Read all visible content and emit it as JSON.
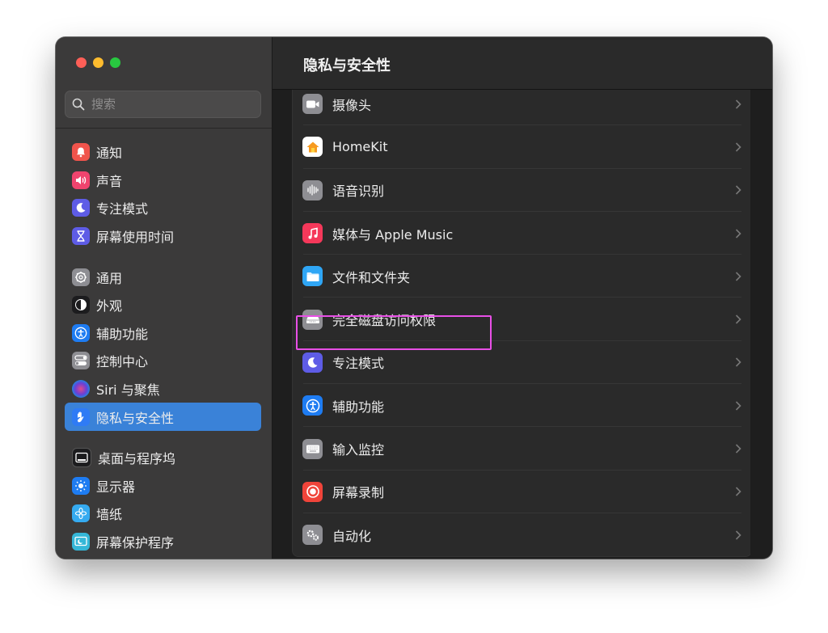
{
  "window": {
    "title": "隐私与安全性"
  },
  "search": {
    "placeholder": "搜索"
  },
  "sidebar": {
    "items": [
      {
        "label": "通知",
        "icon": "bell-icon",
        "color": "#f0544c"
      },
      {
        "label": "声音",
        "icon": "speaker-icon",
        "color": "#f0446e"
      },
      {
        "label": "专注模式",
        "icon": "moon-icon",
        "color": "#5e5ce6"
      },
      {
        "label": "屏幕使用时间",
        "icon": "hourglass-icon",
        "color": "#5e5ce6"
      },
      {
        "label": "通用",
        "icon": "gear-icon",
        "color": "#8e8e93"
      },
      {
        "label": "外观",
        "icon": "appearance-icon",
        "color": "#1c1c1e"
      },
      {
        "label": "辅助功能",
        "icon": "accessibility-icon",
        "color": "#1e7cf2"
      },
      {
        "label": "控制中心",
        "icon": "toggles-icon",
        "color": "#8e8e93"
      },
      {
        "label": "Siri 与聚焦",
        "icon": "siri-icon",
        "color": "#2b2b55"
      },
      {
        "label": "隐私与安全性",
        "icon": "hand-icon",
        "color": "#2f7bf5",
        "active": true
      },
      {
        "label": "桌面与程序坞",
        "icon": "dock-icon",
        "color": "#1c1c1e"
      },
      {
        "label": "显示器",
        "icon": "sun-icon",
        "color": "#1e7cf2"
      },
      {
        "label": "墙纸",
        "icon": "flower-icon",
        "color": "#35aaf0"
      },
      {
        "label": "屏幕保护程序",
        "icon": "screensaver-icon",
        "color": "#35b7d8"
      }
    ]
  },
  "main": {
    "rows": [
      {
        "label": "摄像头",
        "icon": "camera-icon",
        "color": "#8e8e93"
      },
      {
        "label": "HomeKit",
        "icon": "home-icon",
        "color": "#ffffff"
      },
      {
        "label": "语音识别",
        "icon": "waveform-icon",
        "color": "#8e8e93"
      },
      {
        "label": "媒体与 Apple Music",
        "icon": "music-icon",
        "color": "#f5385a"
      },
      {
        "label": "文件和文件夹",
        "icon": "folder-icon",
        "color": "#2fa6f5"
      },
      {
        "label": "完全磁盘访问权限",
        "icon": "disk-icon",
        "color": "#8e8e93"
      },
      {
        "label": "专注模式",
        "icon": "moon-icon",
        "color": "#5e5ce6"
      },
      {
        "label": "辅助功能",
        "icon": "accessibility-icon",
        "color": "#1e7cf2"
      },
      {
        "label": "输入监控",
        "icon": "keyboard-icon",
        "color": "#8e8e93"
      },
      {
        "label": "屏幕录制",
        "icon": "record-icon",
        "color": "#f0443a"
      },
      {
        "label": "自动化",
        "icon": "gears-icon",
        "color": "#8e8e93"
      }
    ]
  },
  "highlight": {
    "color": "#e84fe6"
  }
}
